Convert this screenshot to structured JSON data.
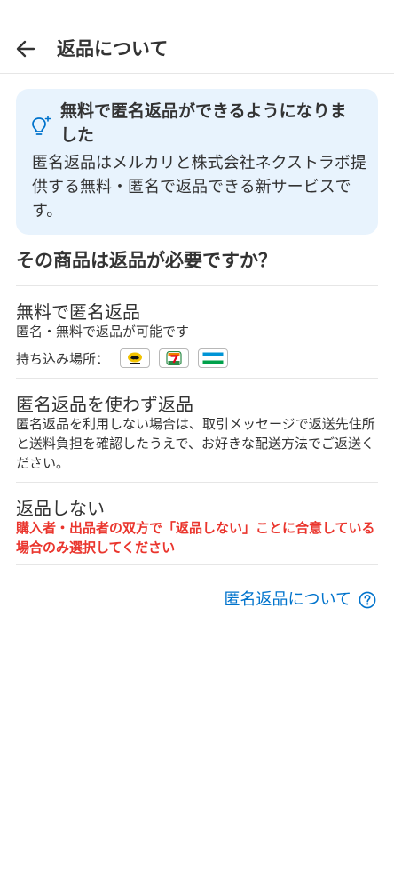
{
  "header": {
    "title": "返品について"
  },
  "info": {
    "heading": "無料で匿名返品ができるようになりました",
    "body": "匿名返品はメルカリと株式会社ネクストラボ提供する無料・匿名で返品できる新サービスです。"
  },
  "question": "その商品は返品が必要ですか？",
  "options": [
    {
      "title": "無料で匿名返品",
      "desc": "匿名・無料で返品が可能です",
      "dropoff_label": "持ち込み場所："
    },
    {
      "title": "匿名返品を使わず返品",
      "desc": "匿名返品を利用しない場合は、取引メッセージで返送先住所と送料負担を確認したうえで、お好きな配送方法でご返送ください。"
    },
    {
      "title": "返品しない",
      "warning": "購入者・出品者の双方で「返品しない」ことに合意している場合のみ選択してください"
    }
  ],
  "stores": [
    {
      "icon": "yamato-icon"
    },
    {
      "icon": "seven-eleven-icon"
    },
    {
      "icon": "familymart-icon"
    }
  ],
  "footer": {
    "about_link": "匿名返品について"
  },
  "colors": {
    "accent": "#0073cc",
    "card_bg": "#e8f3fd",
    "warning": "#ea352d",
    "text": "#333333",
    "divider": "#e6e6e6"
  }
}
